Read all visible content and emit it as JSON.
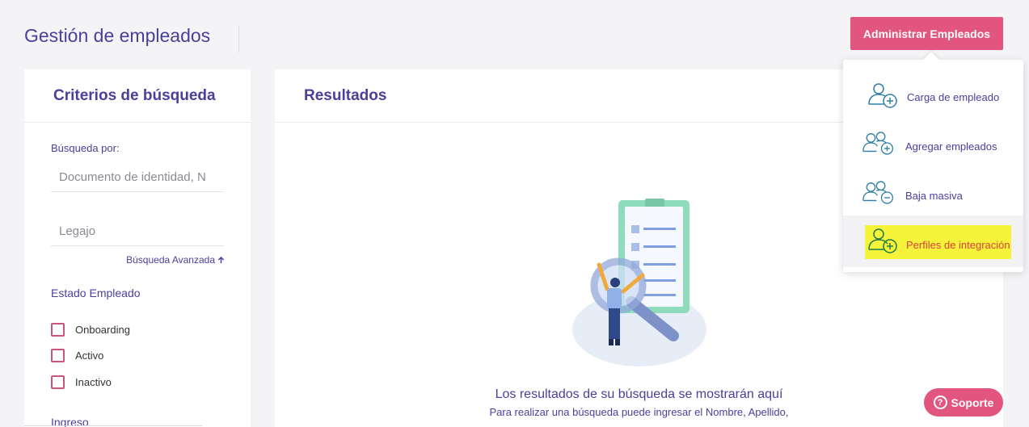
{
  "header": {
    "title": "Gestión de empleados",
    "admin_button": "Administrar Empleados"
  },
  "criteria": {
    "title": "Criterios de búsqueda",
    "search_by_label": "Búsqueda por:",
    "doc_placeholder": "Documento de identidad, N",
    "legajo_placeholder": "Legajo",
    "advanced_link": "Búsqueda Avanzada",
    "estado_label": "Estado Empleado",
    "estados": [
      "Onboarding",
      "Activo",
      "Inactivo"
    ],
    "ingreso_label": "Ingreso"
  },
  "results": {
    "title": "Resultados",
    "empty_title": "Los resultados de su búsqueda se mostrarán aquí",
    "empty_desc": "Para realizar una búsqueda puede ingresar el Nombre, Apellido,"
  },
  "dropdown": {
    "items": [
      {
        "label": "Carga de empleado",
        "icon": "user-plus-icon"
      },
      {
        "label": "Agregar empleados",
        "icon": "users-plus-icon"
      },
      {
        "label": "Baja masiva",
        "icon": "users-minus-icon"
      },
      {
        "label": "Perfiles de integración",
        "icon": "user-plus-icon",
        "highlighted": true
      }
    ]
  },
  "support": {
    "label": "Soporte"
  },
  "colors": {
    "accent": "#e2557f",
    "primary_text": "#4a3f9a",
    "highlight": "#f5f33a",
    "highlight_text": "#d9433f"
  }
}
